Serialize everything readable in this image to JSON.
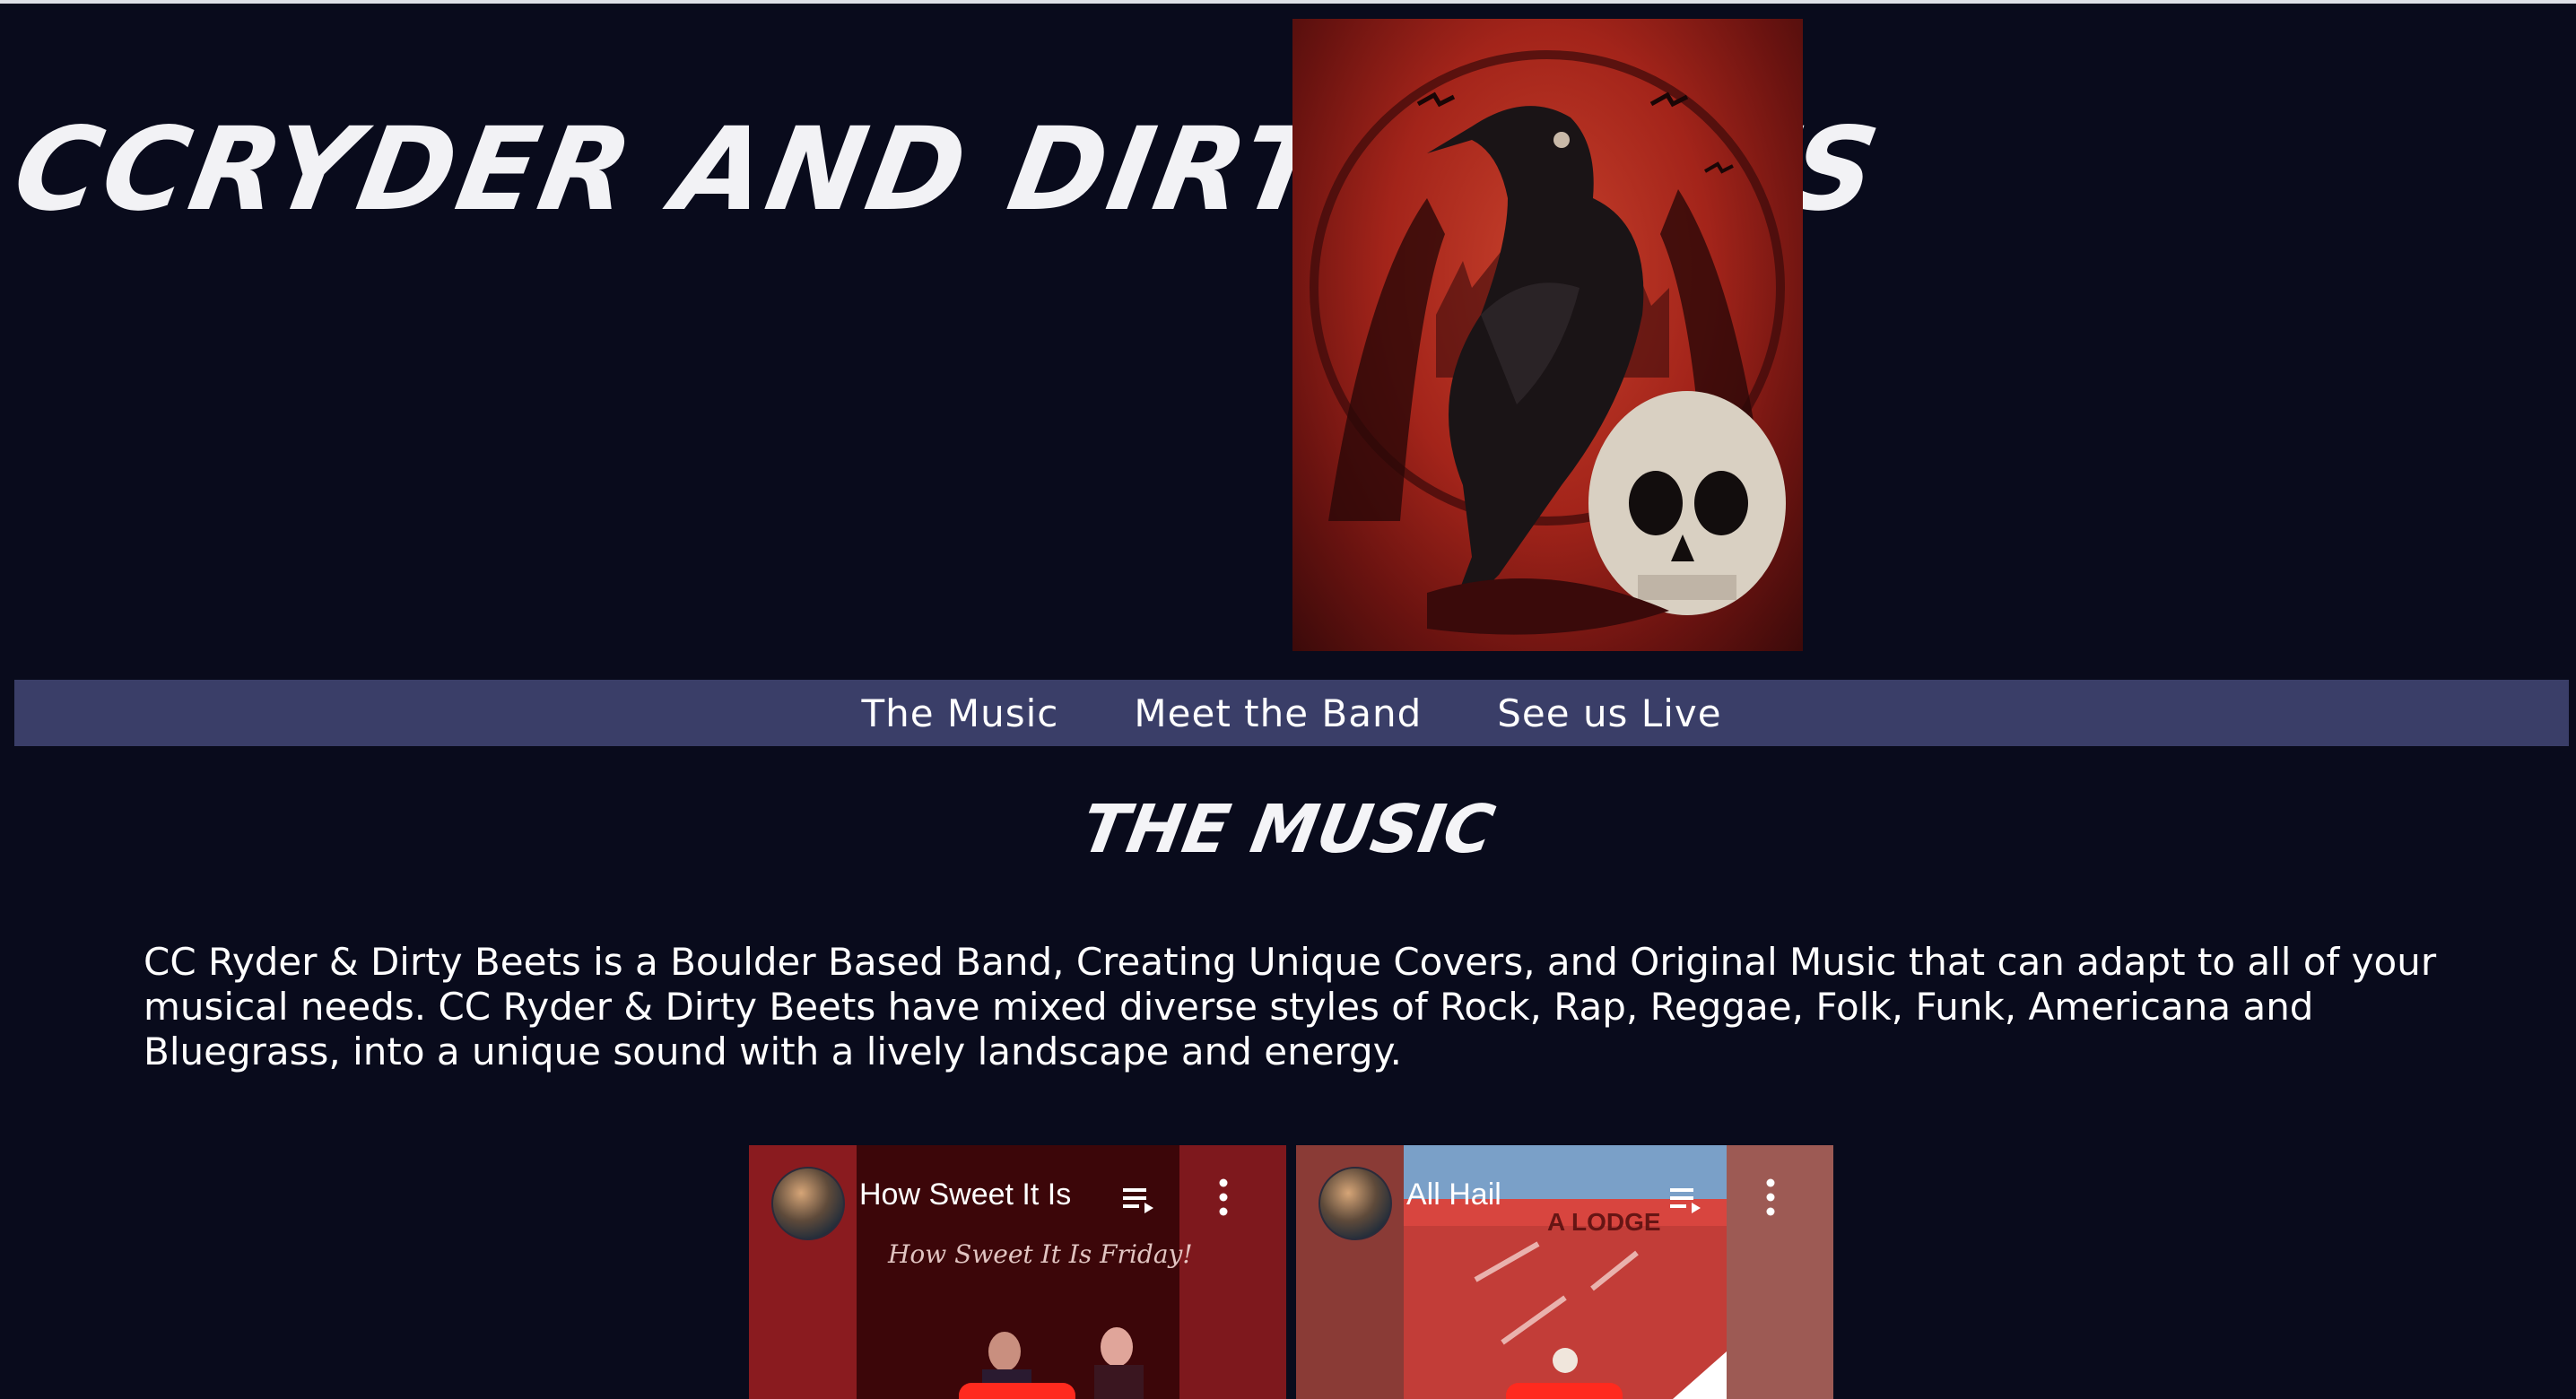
{
  "header": {
    "band_title": "CCRYDER AND DIRTY BEETS"
  },
  "nav": {
    "items": [
      "The Music",
      "Meet the Band",
      "See us Live"
    ]
  },
  "section": {
    "title": "THE MUSIC",
    "intro": "CC Ryder & Dirty Beets is a Boulder Based Band, Creating Unique Covers, and Original Music that can adapt to all of your musical needs. CC Ryder & Dirty Beets have mixed diverse styles of Rock, Rap, Reggae, Folk, Funk, Americana and Bluegrass, into a unique sound with a lively landscape and energy."
  },
  "videos": [
    {
      "title": "How Sweet It Is",
      "caption": "How Sweet It Is Friday!"
    },
    {
      "title": "All Hail",
      "caption": "A LODGE"
    }
  ],
  "colors": {
    "background": "#090b1c",
    "nav_bar": "#3a3e68",
    "text": "#ffffff",
    "play_button": "#ff2a1e"
  }
}
